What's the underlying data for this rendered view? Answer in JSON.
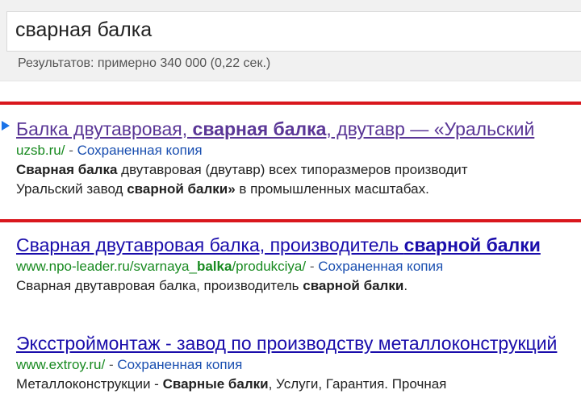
{
  "search": {
    "query": "сварная балка",
    "stats": "Результатов: примерно 340 000 (0,22 сек.)"
  },
  "colors": {
    "link": "#1a0dab",
    "visited_link": "#5a3696",
    "url_green": "#188a20",
    "highlight_red": "#d9171d"
  },
  "results": [
    {
      "title_parts": [
        "Балка двутавровая, ",
        "сварная балка",
        ", двутавр — «Уральский"
      ],
      "url_parts": [
        "uzsb.ru/"
      ],
      "sep": " - ",
      "cache_label": "Сохраненная копия",
      "snippet_line1_parts": [
        "Сварная балка",
        " двутавровая (двутавр) всех типоразмеров производит"
      ],
      "snippet_line2_parts": [
        "Уральский завод ",
        "сварной балки»",
        " в промышленных масштабах."
      ]
    },
    {
      "title_parts": [
        "Сварная двутавровая балка, производитель ",
        "сварной балки"
      ],
      "url_parts": [
        "www.npo-leader.ru/svarnaya_",
        "balka",
        "/produkciya/"
      ],
      "sep": " - ",
      "cache_label": "Сохраненная копия",
      "snippet_line1_parts": [
        "Сварная двутавровая балка, производитель ",
        "сварной балки",
        "."
      ]
    },
    {
      "title_parts": [
        "Эксстроймонтаж - завод по производству металлоконструкций"
      ],
      "url_parts": [
        "www.extroy.ru/"
      ],
      "sep": " - ",
      "cache_label": "Сохраненная копия",
      "snippet_line1_parts": [
        "Металлоконструкции - ",
        "Сварные балки",
        ", Услуги, Гарантия. Прочная"
      ]
    }
  ]
}
